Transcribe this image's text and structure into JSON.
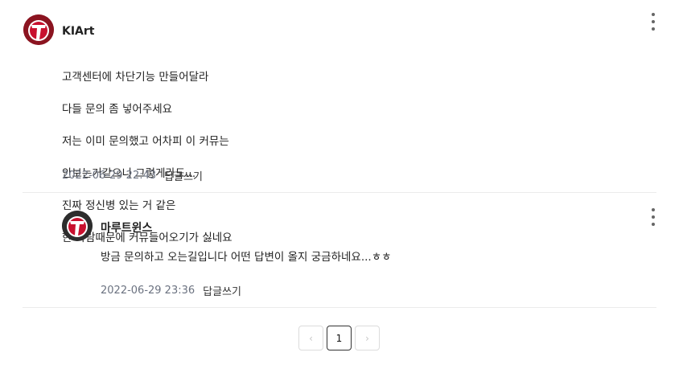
{
  "comments": [
    {
      "author": "KIArt",
      "lines": [
        "고객센터에 차단기능 만들어달라",
        "다들 문의 좀 넣어주세요",
        "저는 이미 문의했고 어차피 이 커뮤는",
        "안보는거같으니 그렇게라도...",
        "진짜 정신병 있는 거 같은",
        "한 사람때문에 커뮤들어오기가 싫네요"
      ],
      "date": "2022-06-29 22:43",
      "reply_label": "답글쓰기",
      "avatar_colors": {
        "bg": "#8b1420",
        "ring": "#ffffff",
        "letter": "#c8102e"
      }
    },
    {
      "author": "마루트윈스",
      "text": "방금 문의하고 오는길입니다 어떤 답변이 올지 궁금하네요...ㅎㅎ",
      "date": "2022-06-29 23:36",
      "reply_label": "답글쓰기",
      "avatar_colors": {
        "bg": "#2d2d2d",
        "ring": "#ffffff",
        "letter": "#c8102e"
      }
    }
  ],
  "pagination": {
    "prev_icon": "‹",
    "current_page": "1",
    "next_icon": "›"
  }
}
